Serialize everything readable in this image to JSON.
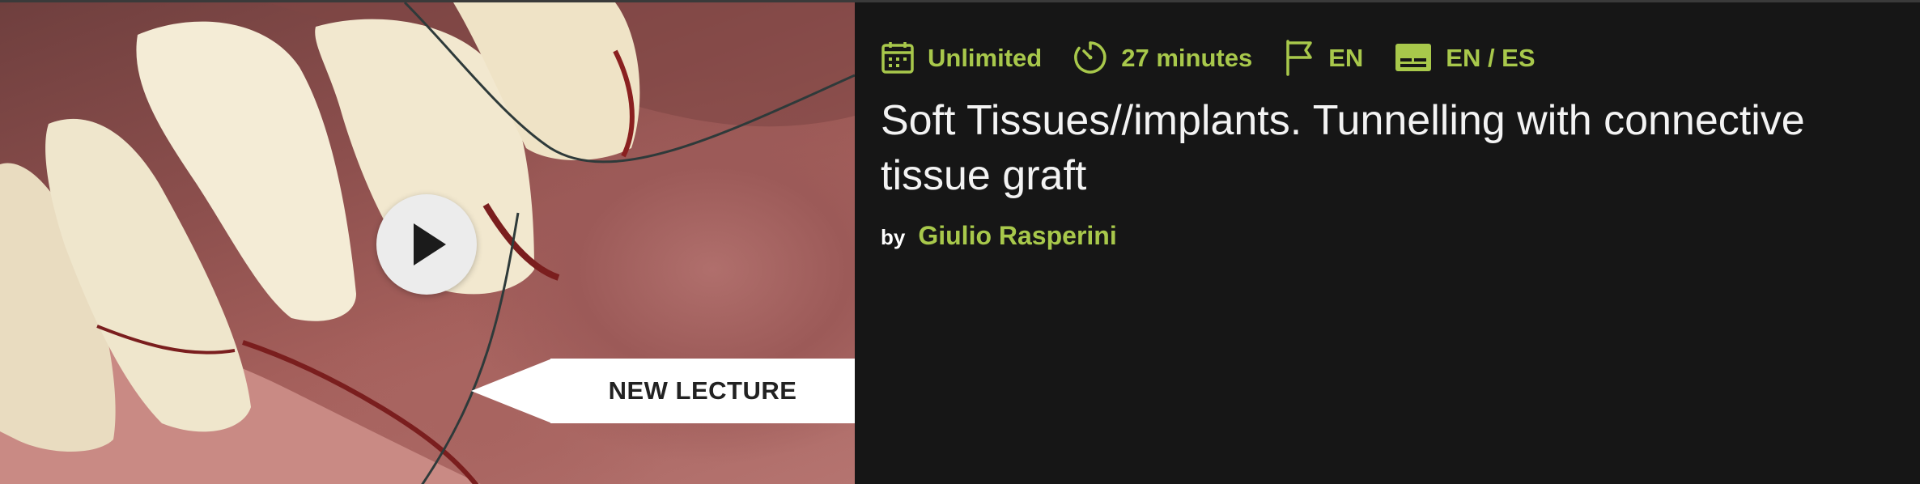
{
  "course": {
    "badge_label": "NEW LECTURE",
    "meta": {
      "access": "Unlimited",
      "duration": "27 minutes",
      "language": "EN",
      "subtitles": "EN / ES"
    },
    "title": "Soft Tissues//implants. Tunnelling with connective tissue graft",
    "by_label": "by",
    "author": "Giulio Rasperini"
  },
  "colors": {
    "accent": "#a8c84b",
    "background": "#161616",
    "title": "#f3f3f3"
  },
  "icons": [
    "calendar-icon",
    "stopwatch-icon",
    "flag-icon",
    "subtitles-icon",
    "play-icon"
  ]
}
